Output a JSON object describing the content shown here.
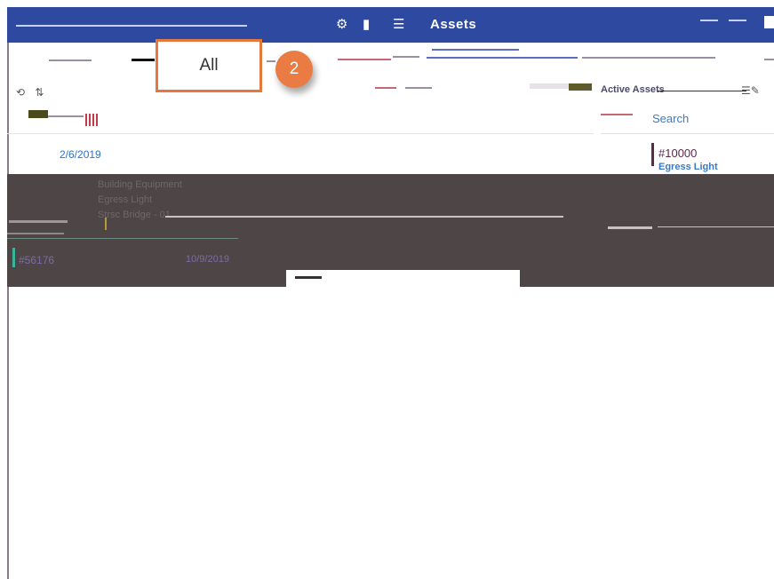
{
  "header": {
    "title": "Assets"
  },
  "filter": {
    "selected_label": "All",
    "step_number": "2"
  },
  "asset_list": {
    "first_date": "2/6/2019",
    "rows": [
      {
        "category": "Building Equipment",
        "type": "Egress Light",
        "location": "Strsc Bridge - 01",
        "id": "#56176",
        "date": "10/9/2019"
      }
    ]
  },
  "side_panel": {
    "title": "Active Assets",
    "search_label": "Search",
    "item": {
      "id": "#10000",
      "name": "Egress Light"
    }
  },
  "colors": {
    "header_blue": "#2d4aa0",
    "callout_orange": "#e5783c",
    "link_blue": "#2f72c4",
    "band_dark": "#4e4646"
  }
}
